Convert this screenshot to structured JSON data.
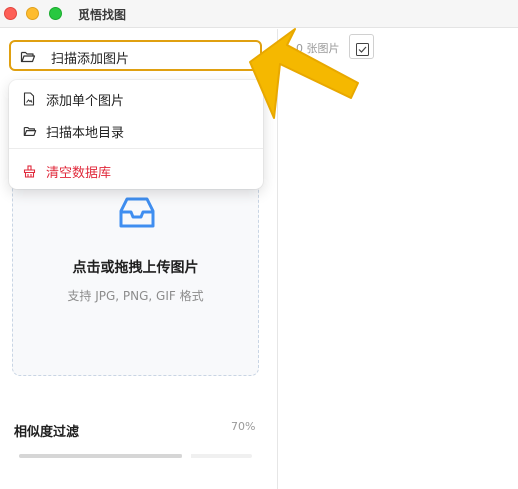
{
  "window": {
    "title": "觅悟找图"
  },
  "left": {
    "scan_button": {
      "label": "扫描添加图片",
      "icon": "folder-open-icon"
    },
    "dropzone": {
      "icon": "inbox-tray-icon",
      "title": "点击或拖拽上传图片",
      "subtitle": "支持 JPG, PNG, GIF 格式"
    },
    "similarity": {
      "label": "相似度过滤",
      "value": "70%",
      "fraction": 0.7
    }
  },
  "menu": {
    "items": [
      {
        "label": "添加单个图片",
        "icon": "file-image-icon"
      },
      {
        "label": "扫描本地目录",
        "icon": "folder-open-icon"
      },
      {
        "label": "清空数据库",
        "icon": "database-clear-icon"
      }
    ]
  },
  "right": {
    "count_text": "0 张图片",
    "select_toggle_icon": "checkbox-icon"
  },
  "colors": {
    "highlight_border": "#e0a010",
    "accent_blue": "#3f8ef0",
    "danger": "#e0293b",
    "annotation_arrow": "#f5b800"
  }
}
